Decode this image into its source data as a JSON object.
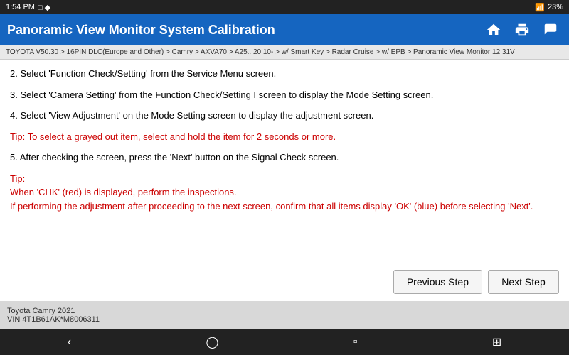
{
  "statusBar": {
    "time": "1:54 PM",
    "battery": "23%",
    "icons": [
      "bluetooth",
      "volume",
      "signal",
      "wifi"
    ]
  },
  "titleBar": {
    "title": "Panoramic View Monitor System Calibration",
    "homeIcon": "home",
    "printIcon": "print",
    "exportIcon": "export"
  },
  "breadcrumb": {
    "text": "TOYOTA V50.30 > 16PIN DLC(Europe and Other) > Camry > AXVA70 > A25...20.10- > w/ Smart Key > Radar Cruise > w/ EPB > Panoramic View Monitor  12.31V"
  },
  "steps": [
    {
      "id": "step2",
      "number": "2.",
      "text": "Select 'Function Check/Setting' from the Service Menu screen.",
      "isTip": false
    },
    {
      "id": "step3",
      "number": "3.",
      "text": "Select 'Camera Setting' from the Function Check/Setting I screen to display the Mode Setting screen.",
      "isTip": false
    },
    {
      "id": "step4",
      "number": "4.",
      "text": "Select 'View Adjustment' on the Mode Setting screen to display the adjustment screen.",
      "isTip": false
    },
    {
      "id": "tip4",
      "number": "",
      "text": "Tip: To select a grayed out item, select and hold the item for 2 seconds or more.",
      "isTip": true
    },
    {
      "id": "step5",
      "number": "5.",
      "text": "After checking the screen, press the 'Next' button on the Signal Check screen.",
      "isTip": false
    },
    {
      "id": "tip5",
      "number": "",
      "text": "Tip:\nWhen 'CHK' (red) is displayed, perform the inspections.\nIf performing the adjustment after proceeding to the next screen, confirm that all items display 'OK' (blue) before selecting 'Next'.",
      "isTip": true
    }
  ],
  "buttons": {
    "previousStep": "Previous Step",
    "nextStep": "Next Step"
  },
  "footer": {
    "line1": "Toyota Camry 2021",
    "line2": "VIN 4T1B61AK*M8006311"
  },
  "navBar": {
    "back": "‹",
    "home": "⬤",
    "square": "▪",
    "apps": "⊞"
  }
}
